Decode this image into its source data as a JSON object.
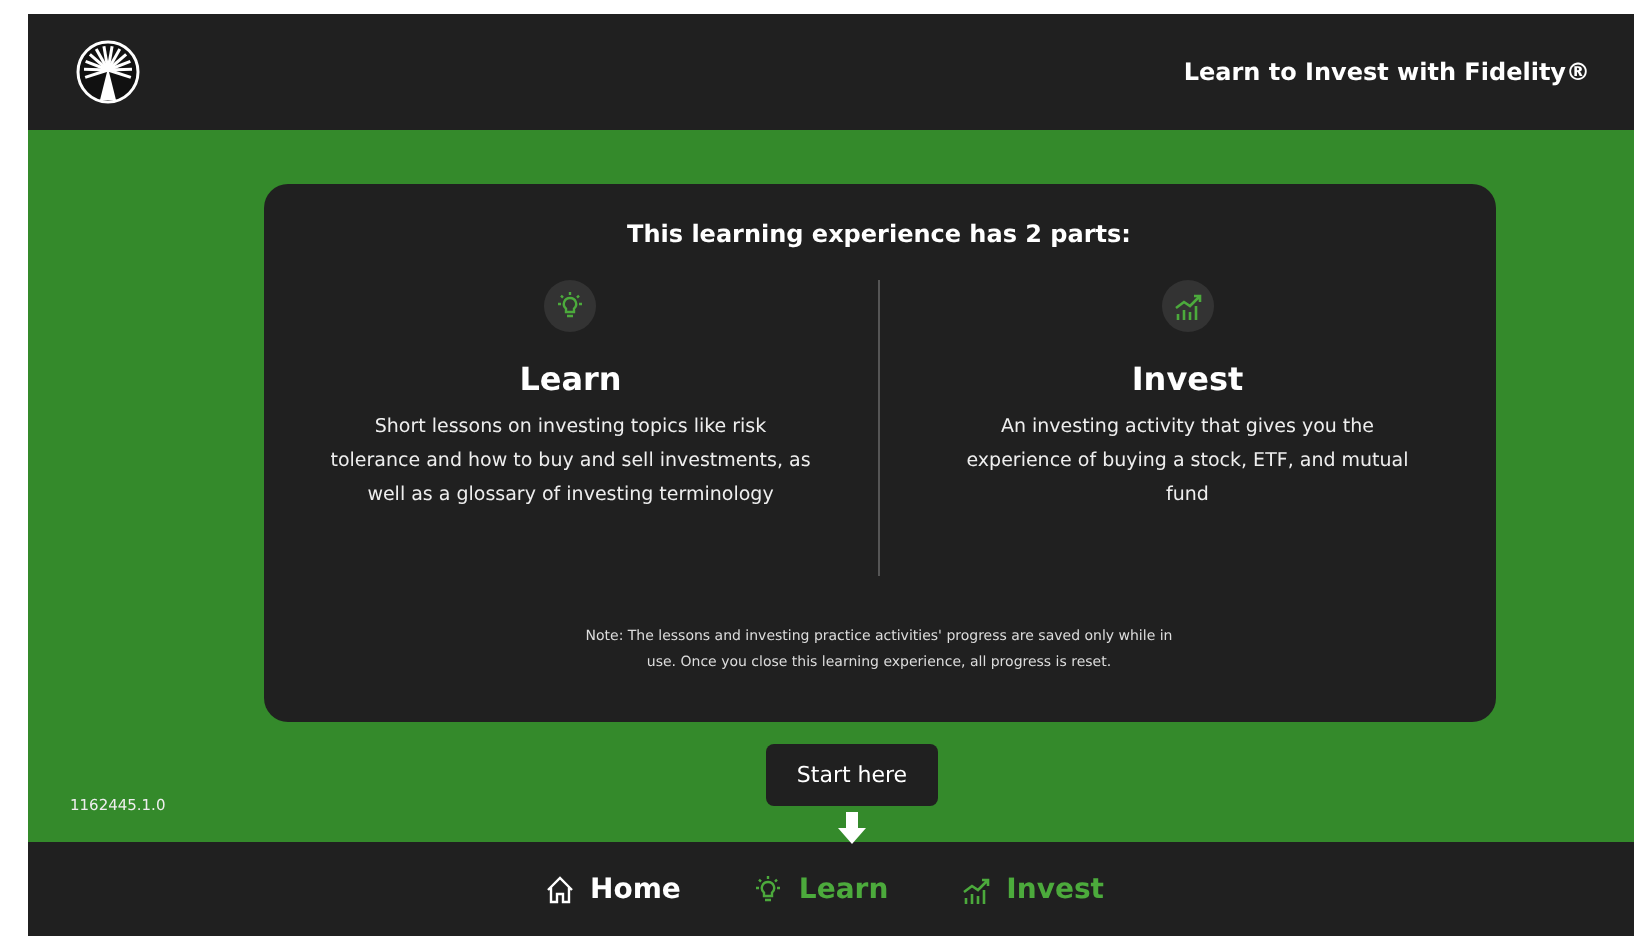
{
  "header": {
    "title": "Learn to Invest with Fidelity®"
  },
  "card": {
    "title": "This learning experience has 2 parts:",
    "parts": [
      {
        "kind": "learn",
        "heading": "Learn",
        "text": "Short lessons on investing topics like risk tolerance and how to buy and sell investments, as well as a glossary of investing terminology"
      },
      {
        "kind": "invest",
        "heading": "Invest",
        "text": "An investing activity that gives you the experience of buying a stock, ETF, and mutual fund"
      }
    ],
    "note": "Note: The lessons and investing practice activities' progress are saved only while in use. Once you close this learning experience, all progress is reset."
  },
  "version": "1162445.1.0",
  "start_button": "Start here",
  "nav": [
    {
      "kind": "home",
      "label": "Home",
      "selected": true
    },
    {
      "kind": "learn",
      "label": "Learn",
      "selected": false
    },
    {
      "kind": "invest",
      "label": "Invest",
      "selected": false
    }
  ]
}
